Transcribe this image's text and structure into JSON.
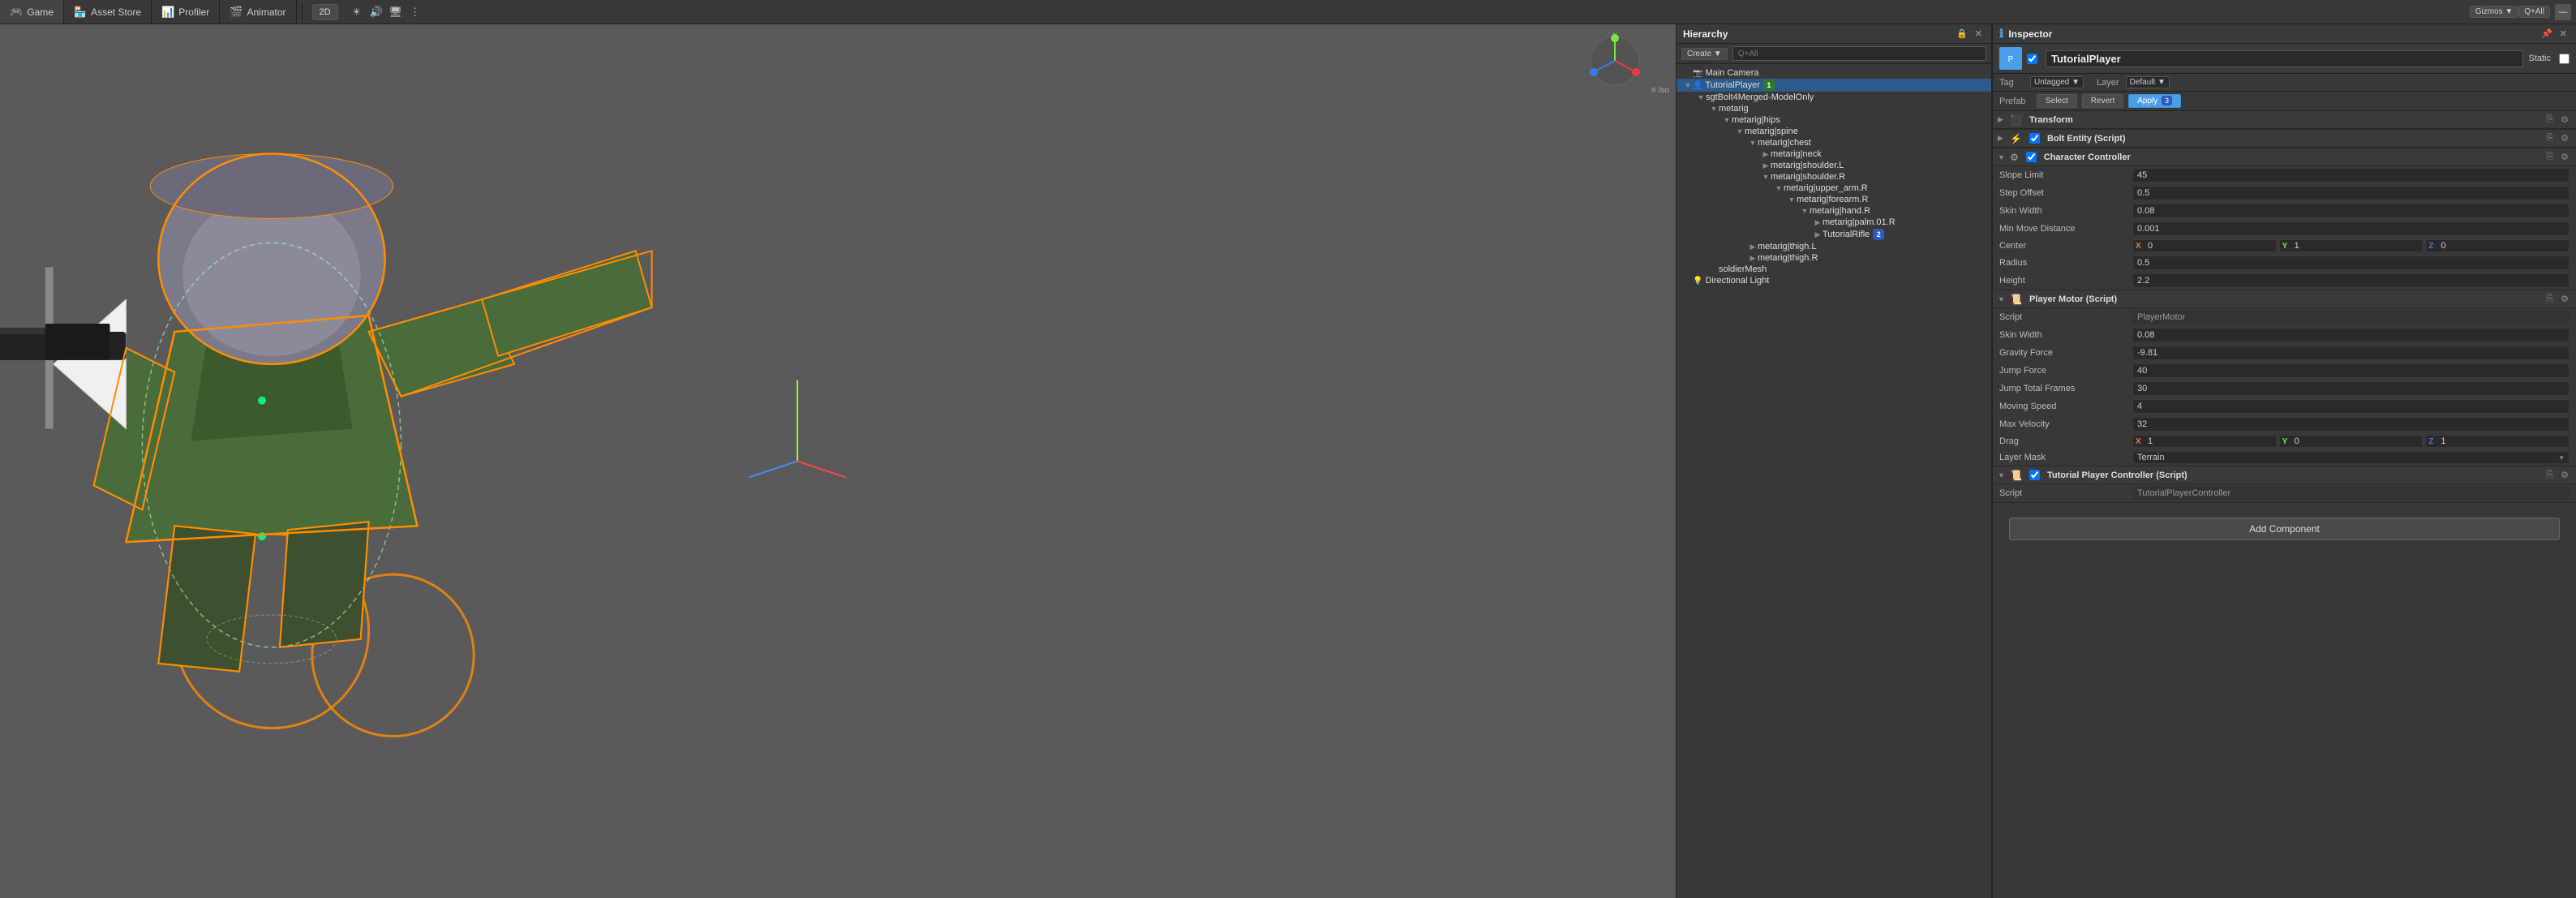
{
  "topbar": {
    "tabs": [
      {
        "label": "Game",
        "icon": "🎮"
      },
      {
        "label": "Asset Store",
        "icon": "🏪"
      },
      {
        "label": "Profiler",
        "icon": "📊"
      },
      {
        "label": "Animator",
        "icon": "🎬"
      }
    ],
    "toggle2d": "2D",
    "gizmos": "Gizmos ▼",
    "all": "Q+All"
  },
  "hierarchy": {
    "title": "Hierarchy",
    "create_btn": "Create ▼",
    "search_placeholder": "Q+All",
    "items": [
      {
        "label": "Main Camera",
        "depth": 0,
        "arrow": "",
        "icon": "📷"
      },
      {
        "label": "TutorialPlayer",
        "depth": 0,
        "arrow": "▼",
        "icon": "👤",
        "badge": "1",
        "badge_color": "green",
        "selected": true
      },
      {
        "label": "sgtBolt4Merged-ModelOnly",
        "depth": 1,
        "arrow": "▼",
        "icon": ""
      },
      {
        "label": "metarig",
        "depth": 2,
        "arrow": "▼",
        "icon": ""
      },
      {
        "label": "metarig|hips",
        "depth": 3,
        "arrow": "▼",
        "icon": ""
      },
      {
        "label": "metarig|spine",
        "depth": 4,
        "arrow": "▼",
        "icon": ""
      },
      {
        "label": "metarig|chest",
        "depth": 5,
        "arrow": "▼",
        "icon": ""
      },
      {
        "label": "metarig|neck",
        "depth": 6,
        "arrow": "▶",
        "icon": ""
      },
      {
        "label": "metarig|shoulder.L",
        "depth": 6,
        "arrow": "▶",
        "icon": ""
      },
      {
        "label": "metarig|shoulder.R",
        "depth": 6,
        "arrow": "▼",
        "icon": ""
      },
      {
        "label": "metarig|upper_arm.R",
        "depth": 7,
        "arrow": "▼",
        "icon": ""
      },
      {
        "label": "metarig|forearm.R",
        "depth": 8,
        "arrow": "▼",
        "icon": ""
      },
      {
        "label": "metarig|hand.R",
        "depth": 9,
        "arrow": "▼",
        "icon": ""
      },
      {
        "label": "metarig|palm.01.R",
        "depth": 10,
        "arrow": "▶",
        "icon": ""
      },
      {
        "label": "TutorialRifle",
        "depth": 10,
        "arrow": "▶",
        "icon": "",
        "badge": "2",
        "badge_color": "blue"
      },
      {
        "label": "metarig|thigh.L",
        "depth": 4,
        "arrow": "▶",
        "icon": ""
      },
      {
        "label": "metarig|thigh.R",
        "depth": 4,
        "arrow": "▶",
        "icon": ""
      },
      {
        "label": "soldierMesh",
        "depth": 2,
        "arrow": "",
        "icon": ""
      },
      {
        "label": "Directional Light",
        "depth": 0,
        "arrow": "",
        "icon": "💡"
      }
    ]
  },
  "inspector": {
    "title": "Inspector",
    "object_name": "TutorialPlayer",
    "static_label": "Static",
    "tag_label": "Tag",
    "tag_value": "Untagged",
    "layer_label": "Layer",
    "layer_value": "Default",
    "prefab_label": "Prefab",
    "select_btn": "Select",
    "revert_btn": "Revert",
    "apply_btn": "Apply",
    "apply_badge": "3",
    "components": [
      {
        "id": "transform",
        "title": "Transform",
        "icon": "⬛",
        "icon_type": "square",
        "checked": false,
        "has_checkbox": false,
        "properties": []
      },
      {
        "id": "bolt_entity",
        "title": "Bolt Entity (Script)",
        "icon": "⚡",
        "icon_type": "lightning",
        "checked": true,
        "has_checkbox": true,
        "properties": []
      },
      {
        "id": "character_controller",
        "title": "Character Controller",
        "icon": "⚙",
        "icon_type": "gear",
        "checked": true,
        "has_checkbox": true,
        "properties": [
          {
            "label": "Slope Limit",
            "type": "number",
            "value": "45"
          },
          {
            "label": "Step Offset",
            "type": "number",
            "value": "0.5"
          },
          {
            "label": "Skin Width",
            "type": "number",
            "value": "0.08"
          },
          {
            "label": "Min Move Distance",
            "type": "number",
            "value": "0.001"
          },
          {
            "label": "Center",
            "type": "xyz",
            "x": "0",
            "y": "1",
            "z": "0"
          },
          {
            "label": "Radius",
            "type": "number",
            "value": "0.5"
          },
          {
            "label": "Height",
            "type": "number",
            "value": "2.2"
          }
        ]
      },
      {
        "id": "player_motor",
        "title": "Player Motor (Script)",
        "icon": "📜",
        "icon_type": "script",
        "checked": false,
        "has_checkbox": false,
        "properties": [
          {
            "label": "Script",
            "type": "ref",
            "value": "PlayerMotor"
          },
          {
            "label": "Skin Width",
            "type": "number",
            "value": "0.08"
          },
          {
            "label": "Gravity Force",
            "type": "number",
            "value": "-9.81"
          },
          {
            "label": "Jump Force",
            "type": "number",
            "value": "40"
          },
          {
            "label": "Jump Total Frames",
            "type": "number",
            "value": "30"
          },
          {
            "label": "Moving Speed",
            "type": "number",
            "value": "4"
          },
          {
            "label": "Max Velocity",
            "type": "number",
            "value": "32"
          },
          {
            "label": "Drag",
            "type": "xyz",
            "x": "1",
            "y": "0",
            "z": "1"
          },
          {
            "label": "Layer Mask",
            "type": "select",
            "value": "Terrain"
          }
        ]
      },
      {
        "id": "tutorial_player_controller",
        "title": "Tutorial Player Controller (Script)",
        "icon": "📜",
        "icon_type": "script",
        "checked": true,
        "has_checkbox": true,
        "properties": [
          {
            "label": "Script",
            "type": "ref",
            "value": "TutorialPlayerController"
          }
        ]
      }
    ],
    "add_component_btn": "Add Component"
  }
}
